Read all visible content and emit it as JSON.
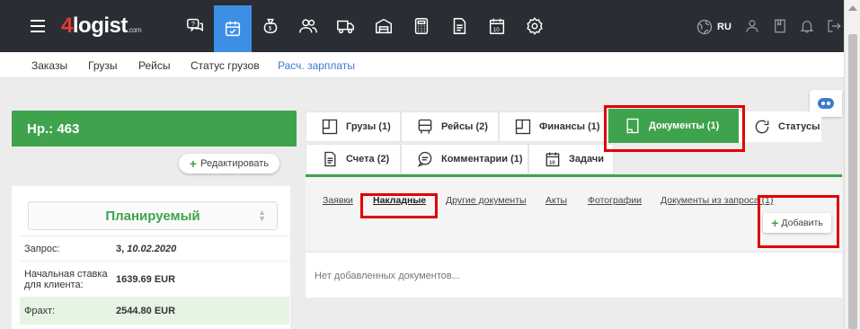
{
  "header": {
    "logo_four": "4",
    "logo_text": "logist",
    "logo_com": ".com",
    "nav_icons": [
      "support-icon",
      "orders-icon",
      "money-bag-icon",
      "contacts-icon",
      "truck-icon",
      "warehouse-icon",
      "calculator-icon",
      "document-icon",
      "calendar-icon",
      "settings-icon"
    ],
    "lang": "RU"
  },
  "subnav": {
    "items": [
      "Заказы",
      "Грузы",
      "Рейсы",
      "Статус грузов",
      "Расч. зарплаты"
    ]
  },
  "order": {
    "number_label": "Нр.: 463",
    "edit_label": "Редактировать",
    "status": "Планируемый",
    "rows": [
      {
        "label": "Запрос:",
        "value_prefix": "3, ",
        "value_italic": "10.02.2020"
      },
      {
        "label": "Начальная ставка для клиента:",
        "value": "1639.69 EUR"
      },
      {
        "label": "Фрахт:",
        "value": "2544.80 EUR"
      }
    ]
  },
  "tabs": {
    "row1": [
      "Грузы (1)",
      "Рейсы (2)",
      "Финансы (1)",
      "Документы (1)",
      "Статусы"
    ],
    "row2": [
      "Счета (2)",
      "Комментарии (1)",
      "Задачи"
    ]
  },
  "doc_subtabs": [
    "Заявки",
    "Накладные",
    "Другие документы",
    "Акты",
    "Фотографии",
    "Документы из запроса (1)"
  ],
  "add_label": "Добавить",
  "empty_text": "Нет добавленных документов...",
  "colors": {
    "green": "#3fa34d",
    "blue": "#3d8fe6",
    "highlight": "#e00000"
  }
}
